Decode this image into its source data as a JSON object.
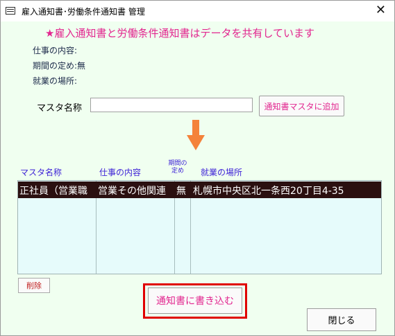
{
  "window": {
    "title": "雇入通知書･労働条件通知書 管理",
    "close_glyph": "✕"
  },
  "banner": "★雇入通知書と労働条件通知書はデータを共有しています",
  "info": {
    "job_label": "仕事の内容:",
    "period_label": "期間の定め:",
    "period_value": "無",
    "place_label": "就業の場所:"
  },
  "master": {
    "label": "マスタ名称",
    "value": "",
    "add_button": "通知書マスタに追加"
  },
  "colors": {
    "accent": "#e2268f",
    "arrow": "#f4823a",
    "header_text": "#3b1fd6",
    "highlight": "#e00000"
  },
  "list": {
    "headers": {
      "name": "マスタ名称",
      "job": "仕事の内容",
      "period_line1": "期間の",
      "period_line2": "定め",
      "place": "就業の場所"
    },
    "rows": [
      {
        "name": "正社員（営業職",
        "job": "営業その他関連",
        "period": "無",
        "place": "札幌市中央区北一条西20丁目4-35"
      }
    ]
  },
  "buttons": {
    "delete": "削除",
    "write": "通知書に書き込む",
    "close": "閉じる"
  }
}
